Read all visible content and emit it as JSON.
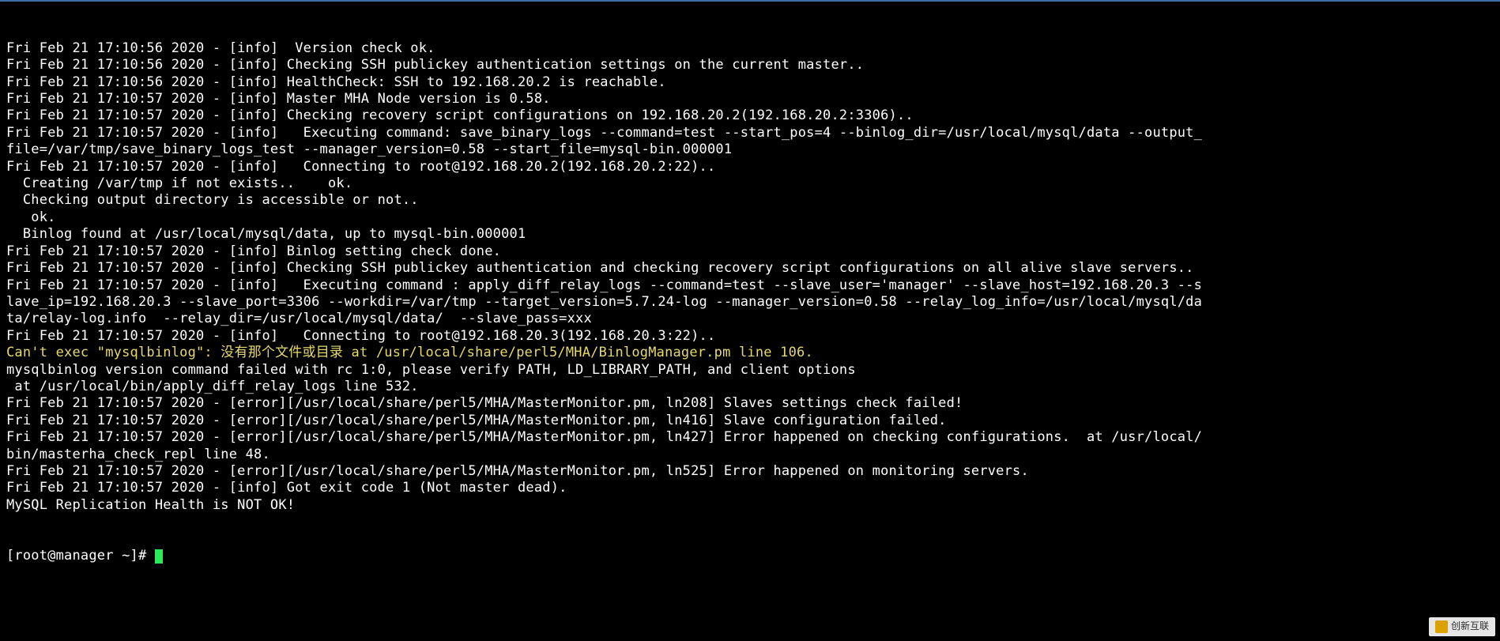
{
  "terminal": {
    "prompt": "[root@manager ~]# ",
    "cursor": true,
    "lines": [
      {
        "t": "Fri Feb 21 17:10:56 2020 - [info]  Version check ok."
      },
      {
        "t": "Fri Feb 21 17:10:56 2020 - [info] Checking SSH publickey authentication settings on the current master.."
      },
      {
        "t": "Fri Feb 21 17:10:56 2020 - [info] HealthCheck: SSH to 192.168.20.2 is reachable."
      },
      {
        "t": "Fri Feb 21 17:10:57 2020 - [info] Master MHA Node version is 0.58."
      },
      {
        "t": "Fri Feb 21 17:10:57 2020 - [info] Checking recovery script configurations on 192.168.20.2(192.168.20.2:3306).."
      },
      {
        "t": "Fri Feb 21 17:10:57 2020 - [info]   Executing command: save_binary_logs --command=test --start_pos=4 --binlog_dir=/usr/local/mysql/data --output_"
      },
      {
        "t": "file=/var/tmp/save_binary_logs_test --manager_version=0.58 --start_file=mysql-bin.000001"
      },
      {
        "t": "Fri Feb 21 17:10:57 2020 - [info]   Connecting to root@192.168.20.2(192.168.20.2:22).."
      },
      {
        "t": "  Creating /var/tmp if not exists..    ok."
      },
      {
        "t": "  Checking output directory is accessible or not.."
      },
      {
        "t": "   ok."
      },
      {
        "t": "  Binlog found at /usr/local/mysql/data, up to mysql-bin.000001"
      },
      {
        "t": "Fri Feb 21 17:10:57 2020 - [info] Binlog setting check done."
      },
      {
        "t": "Fri Feb 21 17:10:57 2020 - [info] Checking SSH publickey authentication and checking recovery script configurations on all alive slave servers.."
      },
      {
        "t": "Fri Feb 21 17:10:57 2020 - [info]   Executing command : apply_diff_relay_logs --command=test --slave_user='manager' --slave_host=192.168.20.3 --s"
      },
      {
        "t": "lave_ip=192.168.20.3 --slave_port=3306 --workdir=/var/tmp --target_version=5.7.24-log --manager_version=0.58 --relay_log_info=/usr/local/mysql/da"
      },
      {
        "t": "ta/relay-log.info  --relay_dir=/usr/local/mysql/data/  --slave_pass=xxx"
      },
      {
        "t": "Fri Feb 21 17:10:57 2020 - [info]   Connecting to root@192.168.20.3(192.168.20.3:22).."
      },
      {
        "t": "Can't exec \"mysqlbinlog\": 没有那个文件或目录 at /usr/local/share/perl5/MHA/BinlogManager.pm line 106.",
        "c": "yellow"
      },
      {
        "t": "mysqlbinlog version command failed with rc 1:0, please verify PATH, LD_LIBRARY_PATH, and client options"
      },
      {
        "t": " at /usr/local/bin/apply_diff_relay_logs line 532."
      },
      {
        "t": "Fri Feb 21 17:10:57 2020 - [error][/usr/local/share/perl5/MHA/MasterMonitor.pm, ln208] Slaves settings check failed!"
      },
      {
        "t": "Fri Feb 21 17:10:57 2020 - [error][/usr/local/share/perl5/MHA/MasterMonitor.pm, ln416] Slave configuration failed."
      },
      {
        "t": "Fri Feb 21 17:10:57 2020 - [error][/usr/local/share/perl5/MHA/MasterMonitor.pm, ln427] Error happened on checking configurations.  at /usr/local/"
      },
      {
        "t": "bin/masterha_check_repl line 48."
      },
      {
        "t": "Fri Feb 21 17:10:57 2020 - [error][/usr/local/share/perl5/MHA/MasterMonitor.pm, ln525] Error happened on monitoring servers."
      },
      {
        "t": "Fri Feb 21 17:10:57 2020 - [info] Got exit code 1 (Not master dead)."
      },
      {
        "t": ""
      },
      {
        "t": "MySQL Replication Health is NOT OK!"
      }
    ]
  },
  "watermark": {
    "text": "创新互联"
  }
}
